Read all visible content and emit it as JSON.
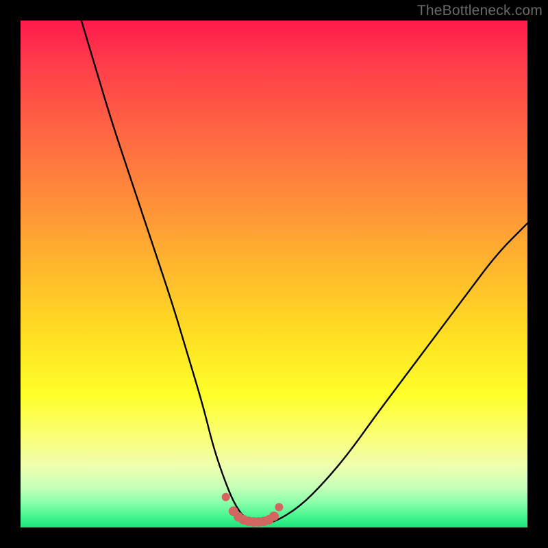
{
  "watermark": "TheBottleneck.com",
  "colors": {
    "frame": "#000000",
    "gradient_top": "#ff1a4d",
    "gradient_mid": "#ffdf22",
    "gradient_bottom": "#1de27a",
    "curve": "#000000",
    "marker": "#d1655f"
  },
  "chart_data": {
    "type": "line",
    "title": "",
    "xlabel": "",
    "ylabel": "",
    "xlim": [
      0,
      100
    ],
    "ylim": [
      0,
      100
    ],
    "note": "Axes are unlabeled; values below are estimated in percent of plot width/height (0=left/bottom, 100=right/top). Curve is a V-shaped bottleneck profile with a flat minimum plateau.",
    "series": [
      {
        "name": "bottleneck-curve",
        "x": [
          12,
          15,
          18,
          22,
          26,
          30,
          33,
          36,
          38,
          40,
          42,
          44,
          46,
          48,
          50,
          55,
          60,
          65,
          70,
          76,
          82,
          88,
          94,
          100
        ],
        "y": [
          100,
          90,
          80,
          68,
          56,
          44,
          34,
          24,
          16,
          10,
          5,
          2,
          1,
          1,
          1,
          4,
          9,
          15,
          22,
          30,
          38,
          46,
          54,
          60
        ]
      }
    ],
    "markers": {
      "name": "plateau-dots",
      "x": [
        40.5,
        42,
        43,
        44,
        45,
        46,
        47,
        48,
        49,
        50,
        51
      ],
      "y": [
        6,
        3.2,
        2.1,
        1.5,
        1.2,
        1.1,
        1.1,
        1.2,
        1.5,
        2.2,
        4
      ],
      "r": [
        6,
        7,
        7,
        7,
        7,
        7,
        7,
        7,
        7,
        7,
        6
      ]
    }
  }
}
